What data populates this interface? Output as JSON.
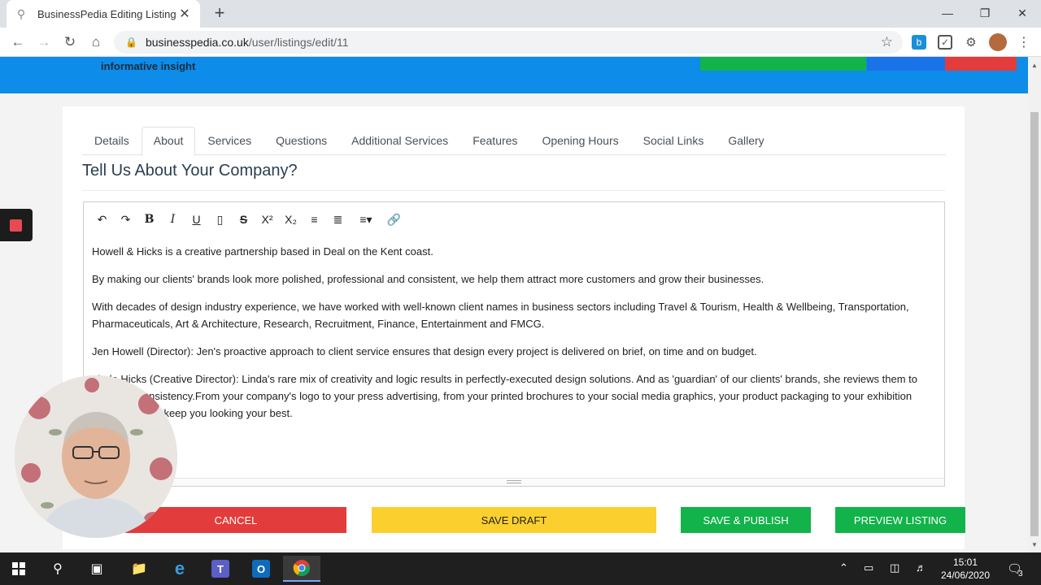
{
  "browser": {
    "tab_title": "BusinessPedia Editing Listing",
    "url_host": "businesspedia.co.uk",
    "url_path": "/user/listings/edit/11"
  },
  "site": {
    "tagline": "informative insight"
  },
  "tabs": [
    {
      "label": "Details"
    },
    {
      "label": "About"
    },
    {
      "label": "Services"
    },
    {
      "label": "Questions"
    },
    {
      "label": "Additional Services"
    },
    {
      "label": "Features"
    },
    {
      "label": "Opening Hours"
    },
    {
      "label": "Social Links"
    },
    {
      "label": "Gallery"
    }
  ],
  "active_tab": "About",
  "section_title": "Tell Us About Your Company?",
  "editor": {
    "paragraphs": [
      "Howell & Hicks is a creative partnership based in Deal on the Kent coast.",
      "By making our clients' brands look more polished, professional and consistent, we help them attract more customers and grow their businesses.",
      "With decades of design industry experience, we have worked with well-known client names in business sectors including Travel & Tourism, Health & Wellbeing, Transportation, Pharmaceuticals, Art & Architecture, Research, Recruitment, Finance, Entertainment and FMCG.",
      "Jen Howell (Director): Jen's proactive approach to client service ensures that design every project is delivered on brief, on time and on budget.",
      "Linda Hicks (Creative Director): Linda's rare mix of creativity and logic results in perfectly-executed design solutions. And as 'guardian' of our clients' brands, she reviews them to check for consistency.From your company's logo to your press advertising, from your printed brochures to your social media graphics, your product packaging to your exhibition materials, we'll keep you looking your best."
    ]
  },
  "buttons": {
    "cancel": "CANCEL",
    "save_draft": "SAVE DRAFT",
    "save_publish": "SAVE & PUBLISH",
    "preview": "PREVIEW LISTING"
  },
  "colors": {
    "header_blue": "#0d8ce9",
    "cancel_red": "#e23c3c",
    "draft_yellow": "#fbcf2e",
    "green": "#12b34a"
  },
  "taskbar": {
    "time": "15:01",
    "date": "24/06/2020",
    "notification_count": "3"
  }
}
